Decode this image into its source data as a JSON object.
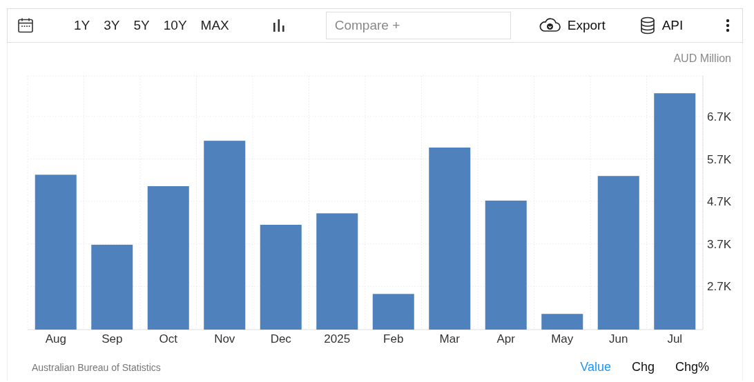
{
  "toolbar": {
    "ranges": [
      {
        "label": "1Y",
        "selected": false
      },
      {
        "label": "3Y",
        "selected": false
      },
      {
        "label": "5Y",
        "selected": false
      },
      {
        "label": "10Y",
        "selected": false
      },
      {
        "label": "MAX",
        "selected": false
      }
    ],
    "compare": {
      "placeholder": "Compare +"
    },
    "export": "Export",
    "api": "API"
  },
  "chart": {
    "unit": "AUD Million",
    "chart_data": {
      "type": "bar",
      "categories": [
        "Aug",
        "Sep",
        "Oct",
        "Nov",
        "Dec",
        "2025",
        "Feb",
        "Mar",
        "Apr",
        "May",
        "Jun",
        "Jul"
      ],
      "grid": true,
      "series": [
        {
          "color": "#4f81bd",
          "values": [
            5.33,
            3.68,
            5.06,
            6.13,
            4.15,
            4.42,
            2.52,
            5.97,
            4.72,
            2.05,
            5.3,
            7.25
          ]
        }
      ],
      "ylim": [
        1.68,
        7.66
      ],
      "yticks": [
        {
          "value": 2.7,
          "label": "2.7K"
        },
        {
          "value": 3.7,
          "label": "3.7K"
        },
        {
          "value": 4.7,
          "label": "4.7K"
        },
        {
          "value": 5.7,
          "label": "5.7K"
        },
        {
          "value": 6.7,
          "label": "6.7K"
        }
      ]
    }
  },
  "footer": {
    "source": "Australian Bureau of Statistics",
    "modes": [
      {
        "label": "Value",
        "selected": true
      },
      {
        "label": "Chg",
        "selected": false
      },
      {
        "label": "Chg%",
        "selected": false
      }
    ]
  }
}
